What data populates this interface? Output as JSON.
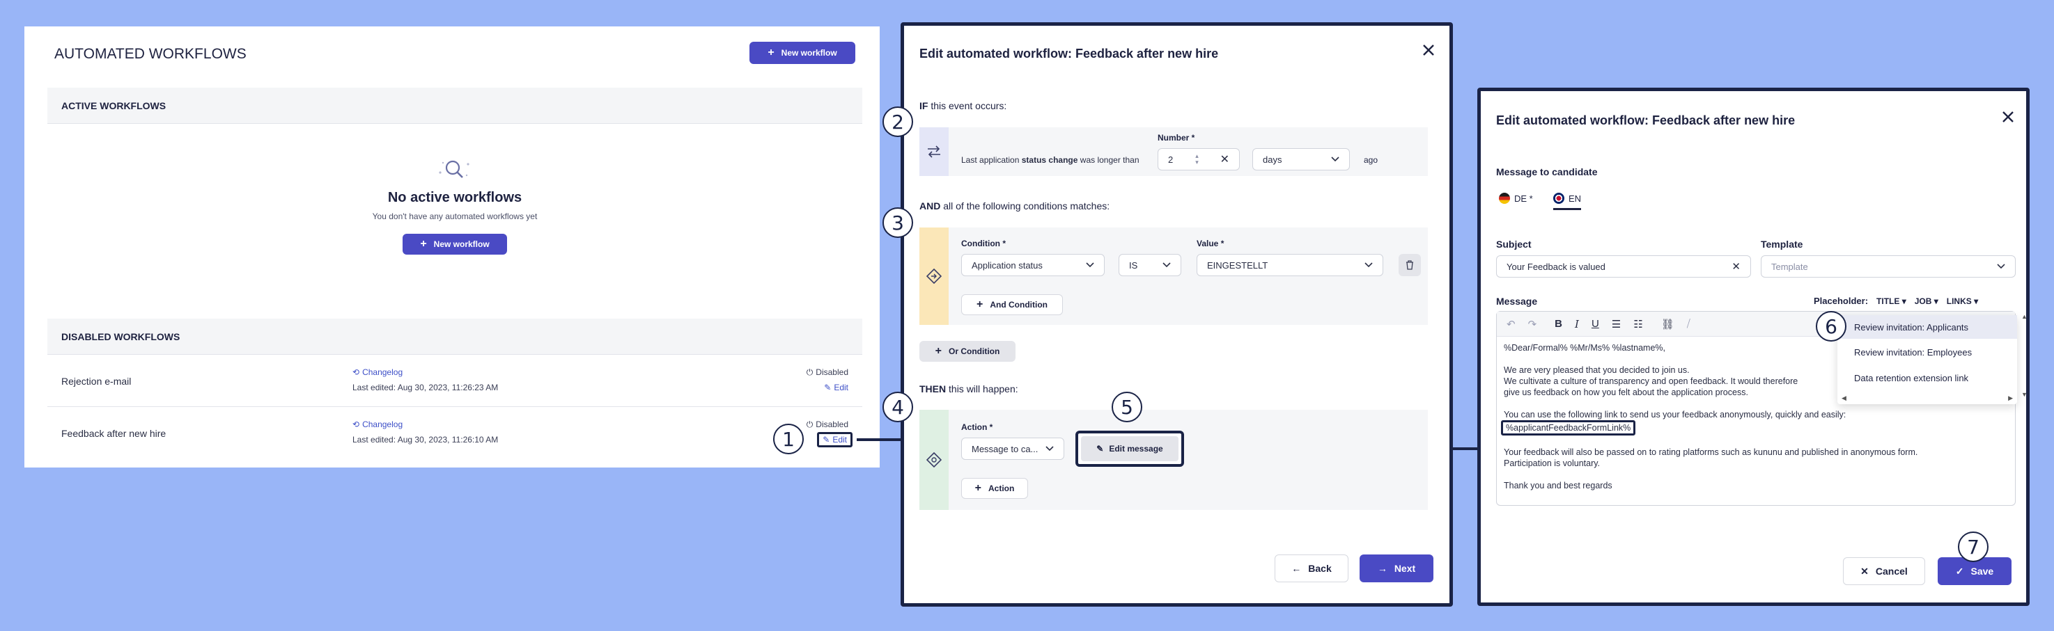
{
  "workflows_panel": {
    "title": "AUTOMATED WORKFLOWS",
    "new_workflow_label": "New workflow",
    "active_header": "ACTIVE WORKFLOWS",
    "empty_title": "No active workflows",
    "empty_subtitle": "You don't have any automated workflows yet",
    "empty_button": "New workflow",
    "disabled_header": "DISABLED WORKFLOWS",
    "rows": [
      {
        "name": "Rejection e-mail",
        "changelog": "Changelog",
        "edited": "Last edited: Aug 30, 2023, 11:26:23 AM",
        "status": "Disabled",
        "edit": "Edit"
      },
      {
        "name": "Feedback after new hire",
        "changelog": "Changelog",
        "edited": "Last edited: Aug 30, 2023, 11:26:10 AM",
        "status": "Disabled",
        "edit": "Edit"
      }
    ]
  },
  "edit_modal": {
    "title": "Edit automated workflow: Feedback after new hire",
    "if_strong": "IF",
    "if_rest": "this event occurs:",
    "trigger_pre": "Last application",
    "trigger_bold": "status change",
    "trigger_post": "was longer than",
    "number_label": "Number *",
    "number_value": "2",
    "unit_value": "days",
    "ago": "ago",
    "and_strong": "AND",
    "and_rest": "all of the following conditions matches:",
    "condition_label": "Condition *",
    "condition_value": "Application status",
    "operator_value": "IS",
    "value_label": "Value *",
    "value_value": "EINGESTELLT",
    "and_condition": "And Condition",
    "or_condition": "Or Condition",
    "then_strong": "THEN",
    "then_rest": "this will happen:",
    "action_label": "Action *",
    "action_value": "Message to ca...",
    "edit_message": "Edit message",
    "action_button": "Action",
    "back": "Back",
    "next": "Next"
  },
  "message_modal": {
    "title": "Edit automated workflow: Feedback after new hire",
    "section": "Message to candidate",
    "lang_de": "DE *",
    "lang_en": "EN",
    "subject_label": "Subject",
    "subject_value": "Your Feedback is valued",
    "template_label": "Template",
    "template_placeholder": "Template",
    "message_label": "Message",
    "placeholder_label": "Placeholder:",
    "ph_title": "TITLE",
    "ph_job": "JOB",
    "ph_links": "LINKS",
    "dropdown": [
      "Review invitation: Applicants",
      "Review invitation: Employees",
      "Data retention extension link"
    ],
    "body_greeting": "%Dear/Formal% %Mr/Ms% %lastname%,",
    "body_p1a": "We are very pleased that you decided to join us.",
    "body_p1b": "We cultivate a culture of transparency and open feedback. It would therefore",
    "body_p1c": "give us feedback on how you felt about the application process.",
    "body_p2": "You can use the following link to send us your feedback anonymously, quickly and easily:",
    "body_link": "%applicantFeedbackFormLink%",
    "body_p3a": "Your feedback will also be passed on to rating platforms such as kununu and published in anonymous form.",
    "body_p3b": "Participation is voluntary.",
    "body_closing": "Thank you and best regards",
    "cancel": "Cancel",
    "save": "Save"
  },
  "callouts": [
    "1",
    "2",
    "3",
    "4",
    "5",
    "6",
    "7"
  ]
}
